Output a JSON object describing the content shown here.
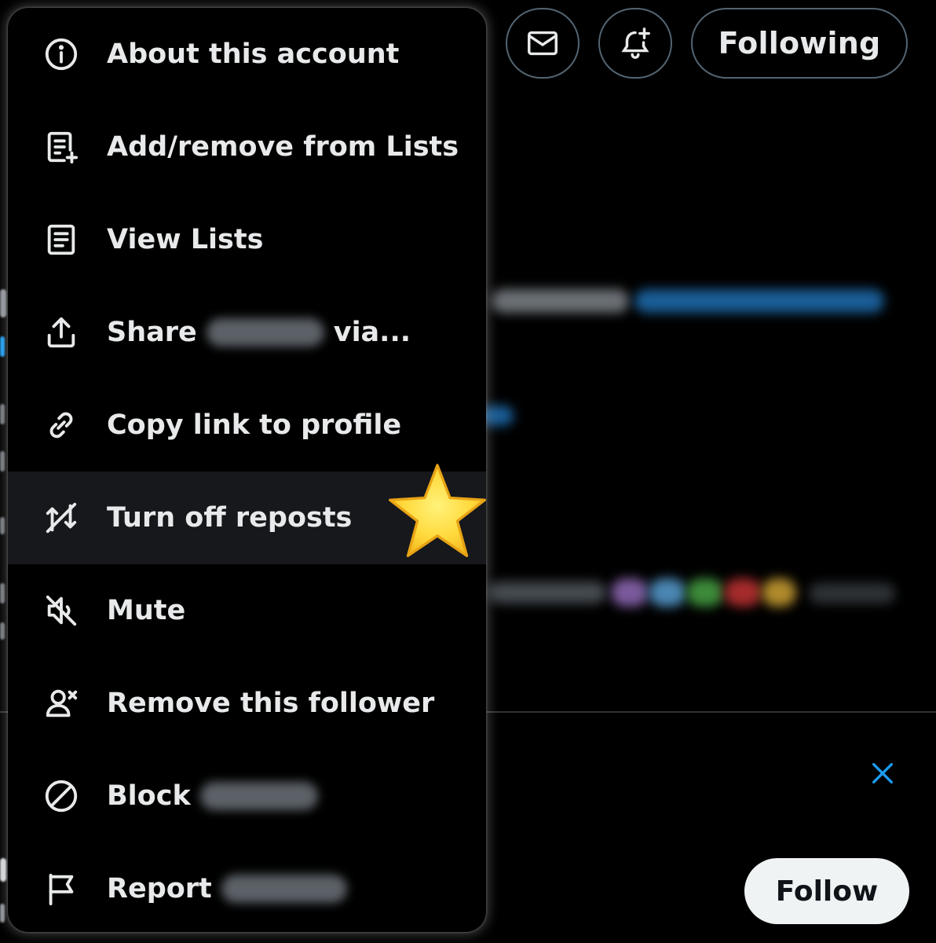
{
  "header": {
    "following_label": "Following",
    "message_icon": "mail-icon",
    "notify_icon": "bell-plus-icon"
  },
  "background": {
    "follow_label": "Follow",
    "close_icon": "close-icon",
    "accent_color": "#1d9bf0"
  },
  "menu": {
    "items": [
      {
        "label": "About this account",
        "icon": "info-icon"
      },
      {
        "label": "Add/remove from Lists",
        "icon": "list-add-icon"
      },
      {
        "label": "View Lists",
        "icon": "list-icon"
      },
      {
        "label": "Share",
        "suffix": "via...",
        "icon": "share-icon"
      },
      {
        "label": "Copy link to profile",
        "icon": "link-icon"
      },
      {
        "label": "Turn off reposts",
        "icon": "repost-off-icon",
        "highlighted": true
      },
      {
        "label": "Mute",
        "icon": "mute-icon"
      },
      {
        "label": "Remove this follower",
        "icon": "remove-user-icon"
      },
      {
        "label": "Block",
        "icon": "block-icon"
      },
      {
        "label": "Report",
        "icon": "flag-icon"
      }
    ]
  },
  "annotation": {
    "icon": "star-icon",
    "color": "#ffd93b"
  }
}
